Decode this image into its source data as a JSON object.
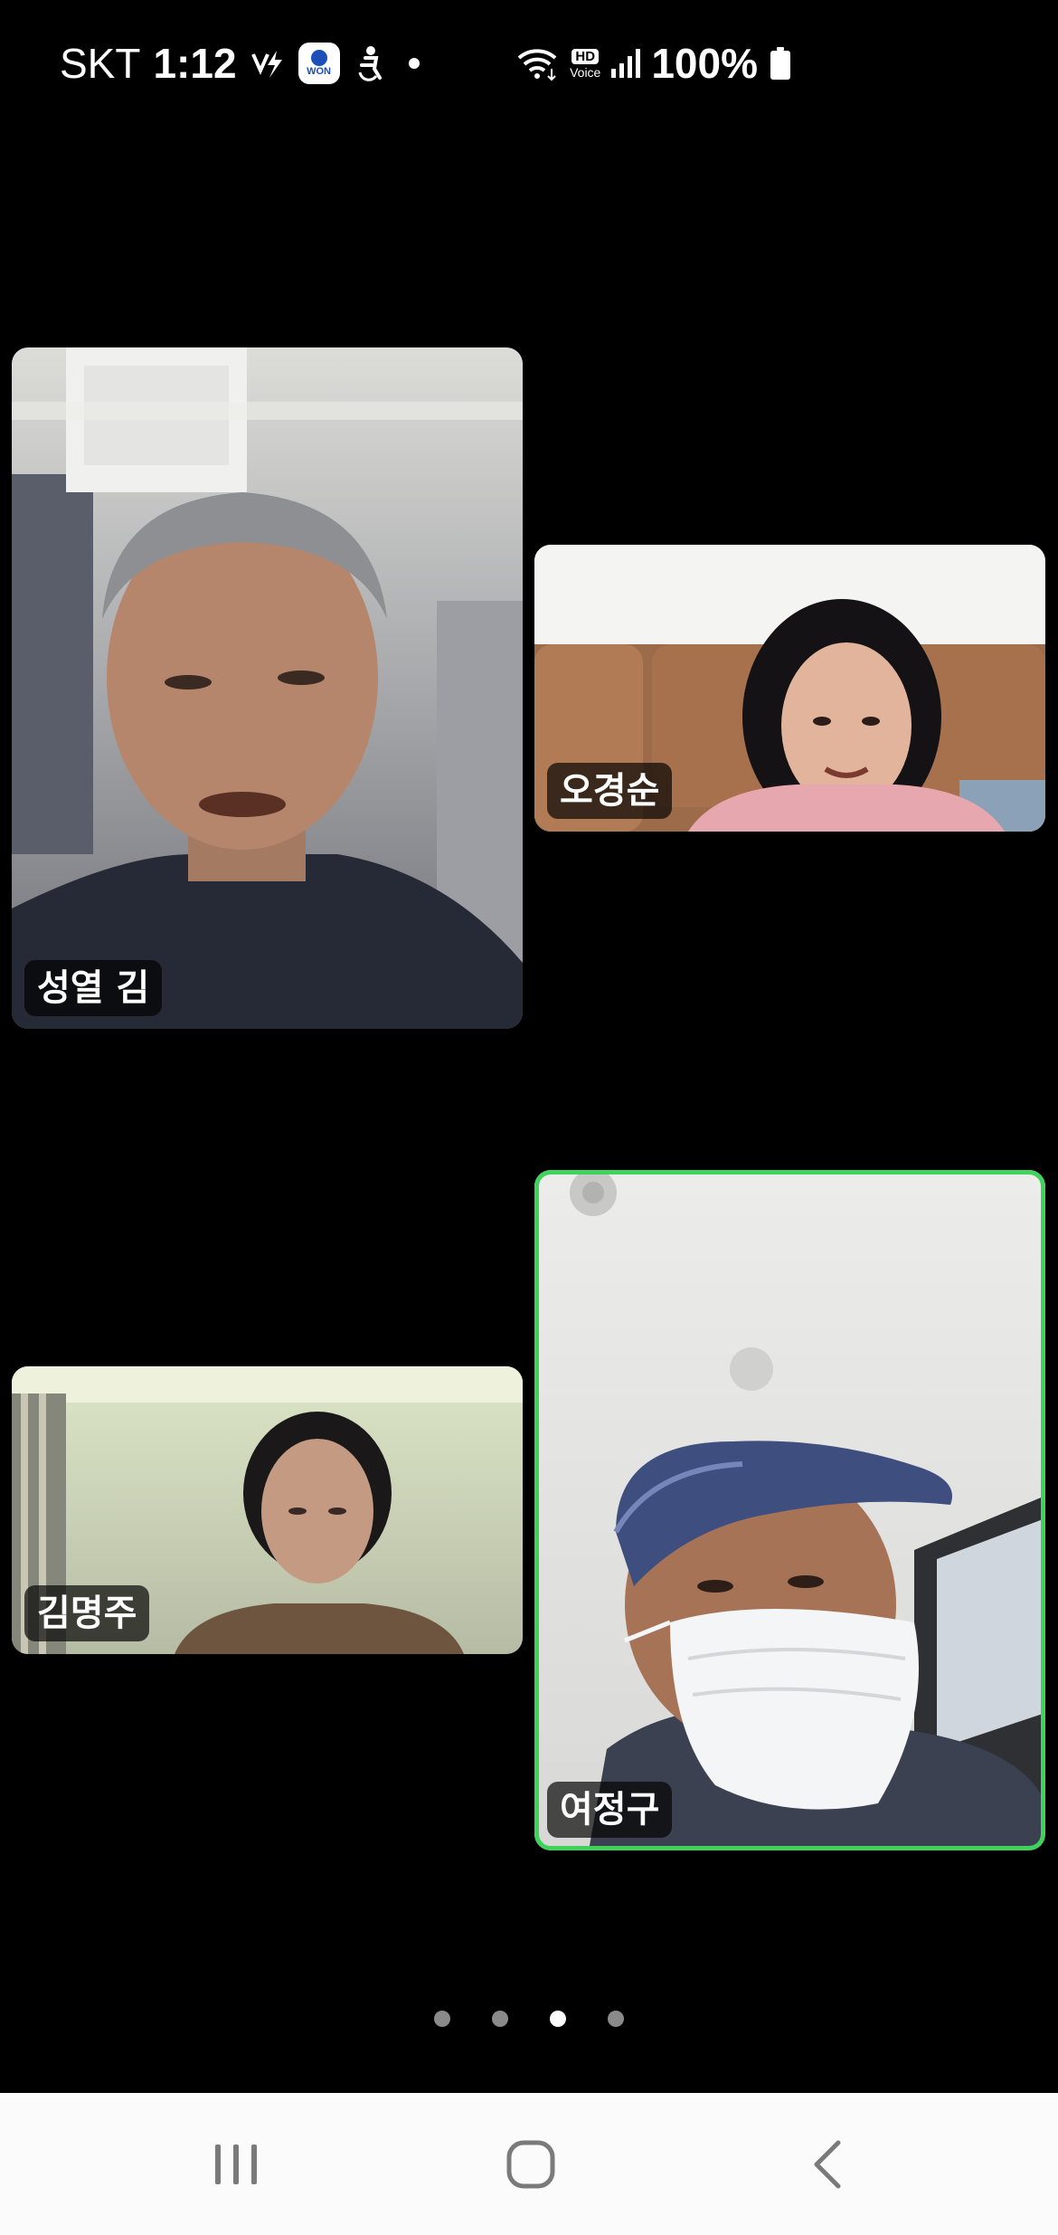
{
  "status_bar": {
    "carrier": "SKT",
    "time": "1:12",
    "won_icon_text": "WON",
    "hd_label": "HD",
    "voice_label": "Voice",
    "battery": "100%",
    "icons": [
      "vpn-key-icon",
      "won-app-icon",
      "accessibility-icon",
      "notification-dot",
      "wifi-icon",
      "hd-voice-icon",
      "signal-icon",
      "battery-icon"
    ]
  },
  "participants": [
    {
      "name": "성열 김",
      "active_speaker": false
    },
    {
      "name": "오경순",
      "active_speaker": false
    },
    {
      "name": "김명주",
      "active_speaker": false
    },
    {
      "name": "여정구",
      "active_speaker": true
    }
  ],
  "pager": {
    "total_pages": 4,
    "current_page": 3
  },
  "colors": {
    "background": "#000000",
    "active_speaker_border": "#3fd35c",
    "nav_bar": "#fbfbfb",
    "nav_icon": "#7a7a7a"
  },
  "nav": {
    "buttons": [
      "recents-icon",
      "home-icon",
      "back-icon"
    ]
  }
}
